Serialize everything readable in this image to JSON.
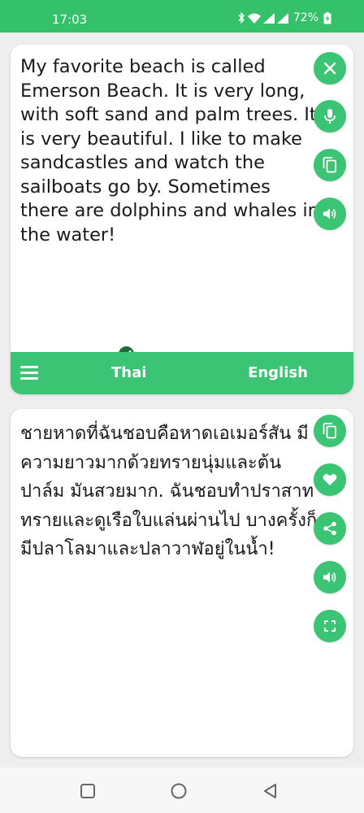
{
  "status_bar": {
    "time": "17:03",
    "battery": "72%"
  },
  "source": {
    "text": "My favorite beach is called Emerson Beach. It is very long, with soft sand and palm trees. It is very beautiful. I like to make sandcastles and watch the sailboats go by. Sometimes there are dolphins and whales in the water!"
  },
  "language_bar": {
    "source_lang": "Thai",
    "target_lang": "English"
  },
  "target": {
    "text": "ชายหาดที่ฉันชอบคือหาดเอเมอร์สัน มีความยาวมากด้วยทรายนุ่มและต้นปาล์ม มันสวยมาก. ฉันชอบทำปราสาททรายและดูเรือใบแล่นผ่านไป บางครั้งก็มีปลาโลมาและปลาวาฬอยู่ในน้ำ!"
  },
  "colors": {
    "accent": "#3cc475",
    "status_bar": "#35c06a",
    "badge": "#1f6b3a"
  },
  "icons": {
    "source_actions": [
      "close-icon",
      "mic-icon",
      "copy-icon",
      "speaker-icon"
    ],
    "target_actions": [
      "copy-icon",
      "heart-icon",
      "share-icon",
      "speaker-icon",
      "fullscreen-icon"
    ],
    "nav": [
      "recents-icon",
      "home-icon",
      "back-icon"
    ]
  }
}
